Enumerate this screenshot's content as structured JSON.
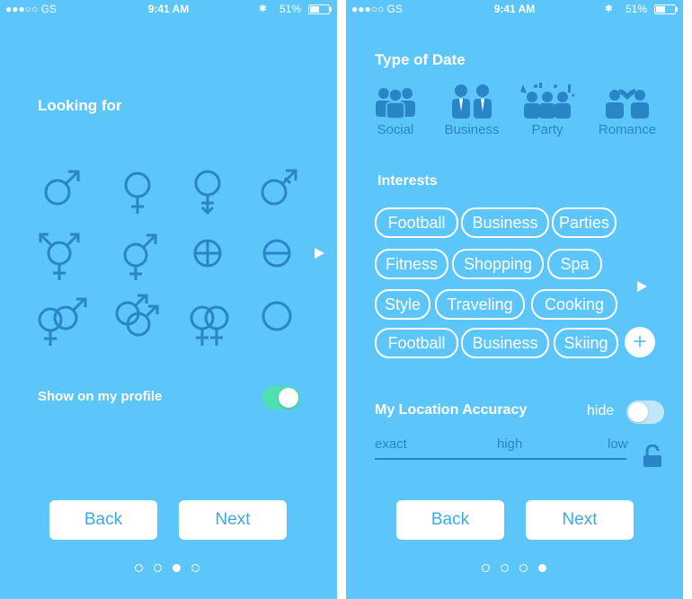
{
  "status_bar": {
    "carrier": "●●●○○ GS",
    "time": "9:41 AM",
    "bluetooth": "✱",
    "battery": "51%"
  },
  "looking_for": {
    "title": "Looking for",
    "icons": [
      "male-symbol",
      "female-symbol",
      "female-down-arrow-symbol",
      "male-arrow-symbol",
      "transgender-symbol",
      "female-male-symbol",
      "circle-plus-symbol",
      "circle-minus-symbol",
      "male-female-linked-symbol",
      "male-male-linked-symbol",
      "female-female-linked-symbol",
      "circle-symbol"
    ],
    "show_on_profile_label": "Show on my profile",
    "show_on_profile_on": true,
    "back_label": "Back",
    "next_label": "Next",
    "pages": 4,
    "active_page": 2
  },
  "date_prefs": {
    "type_title": "Type of Date",
    "types": [
      {
        "label": "Social",
        "icon": "group-icon"
      },
      {
        "label": "Business",
        "icon": "business-people-icon"
      },
      {
        "label": "Party",
        "icon": "party-icon"
      },
      {
        "label": "Romance",
        "icon": "couple-heart-icon"
      }
    ],
    "interests_title": "Interests",
    "interests": [
      [
        "Football",
        "Business",
        "Parties"
      ],
      [
        "Fitness",
        "Shopping",
        "Spa"
      ],
      [
        "Style",
        "Traveling",
        "Cooking"
      ],
      [
        "Football",
        "Business",
        "Skiing"
      ]
    ],
    "location_title": "My Location Accuracy",
    "hide_label": "hide",
    "hide_on": false,
    "accuracy_labels": [
      "exact",
      "high",
      "low"
    ],
    "back_label": "Back",
    "next_label": "Next",
    "pages": 4,
    "active_page": 3
  },
  "colors": {
    "background": "#5cc6fb",
    "icon": "#2a85c6",
    "toggle_on": "#4fe0b0"
  }
}
